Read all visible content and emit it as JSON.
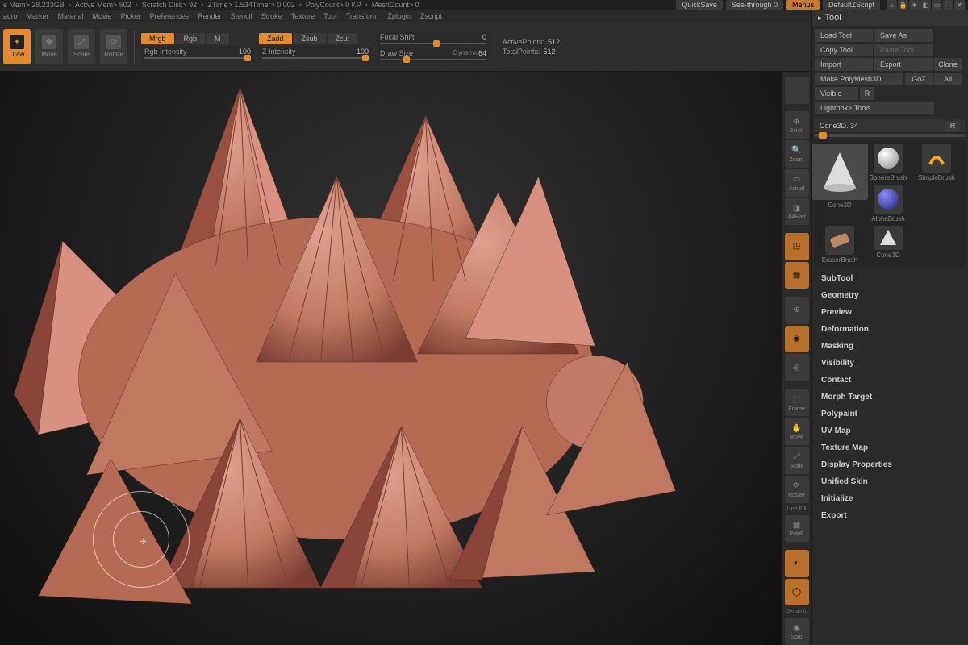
{
  "status": {
    "mem": "e Mem> 28.233GB",
    "activemem": "Active Mem> 502",
    "scratch": "Scratch Disk> 92",
    "ztime": "ZTime> 1.534",
    "timer": "Timer> 0.002",
    "polycount": "PolyCount> 0 KP",
    "meshcount": "MeshCount> 0",
    "quicksave": "QuickSave",
    "seethrough": "See-through  0",
    "menus": "Menus",
    "defaultscript": "DefaultZScript"
  },
  "menus": [
    "acro",
    "Marker",
    "Material",
    "Movie",
    "Picker",
    "Preferences",
    "Render",
    "Stencil",
    "Stroke",
    "Texture",
    "Tool",
    "Transform",
    "Zplugin",
    "Zscript"
  ],
  "modes": {
    "draw": "Draw",
    "move": "Move",
    "scale": "Scale",
    "rotate": "Rotate"
  },
  "rgb": {
    "mrgb": "Mrgb",
    "rgb": "Rgb",
    "m": "M",
    "intensity_label": "Rgb Intensity",
    "intensity_value": "100"
  },
  "z": {
    "zadd": "Zadd",
    "zsub": "Zsub",
    "zcut": "Zcut",
    "intensity_label": "Z Intensity",
    "intensity_value": "100"
  },
  "focal": {
    "label": "Focal Shift",
    "value": "0"
  },
  "drawsize": {
    "label": "Draw Size",
    "value": "64",
    "dynamic": "Dynamic"
  },
  "stats": {
    "active_label": "ActivePoints:",
    "active_value": "512",
    "total_label": "TotalPoints:",
    "total_value": "512"
  },
  "viewport_buttons": [
    "",
    "Scroll",
    "Zoom",
    "Actual",
    "AAHalf",
    "",
    "",
    "",
    "",
    "",
    "",
    "",
    "Frame",
    "Move",
    "Scale",
    "Rotate",
    "Line Fill",
    "PolyF",
    "",
    "",
    "",
    "Dynamic",
    "Solo"
  ],
  "panel": {
    "title": "Tool",
    "loadtool": "Load Tool",
    "saveas": "Save As",
    "copytool": "Copy Tool",
    "pastetool": "Paste Tool",
    "import": "Import",
    "export": "Export",
    "clone": "Clone",
    "makepoly": "Make PolyMesh3D",
    "goz": "GoZ",
    "all": "All",
    "visible": "Visible",
    "r1": "R",
    "lightbox": "Lightbox> Tools",
    "toolname": "Cone3D. 34",
    "r2": "R"
  },
  "tools": [
    {
      "name": "Cone3D",
      "type": "cone"
    },
    {
      "name": "SphereBrush",
      "type": "sphere"
    },
    {
      "name": "AlphaBrush",
      "type": "alpha"
    },
    {
      "name": "SimpleBrush",
      "type": "simple"
    },
    {
      "name": "EraserBrush",
      "type": "eraser"
    },
    {
      "name": "Cone3D",
      "type": "cone-small"
    }
  ],
  "sections": [
    "SubTool",
    "Geometry",
    "Preview",
    "Deformation",
    "Masking",
    "Visibility",
    "Contact",
    "Morph Target",
    "Polypaint",
    "UV Map",
    "Texture Map",
    "Display Properties",
    "Unified Skin",
    "Initialize",
    "Export"
  ]
}
